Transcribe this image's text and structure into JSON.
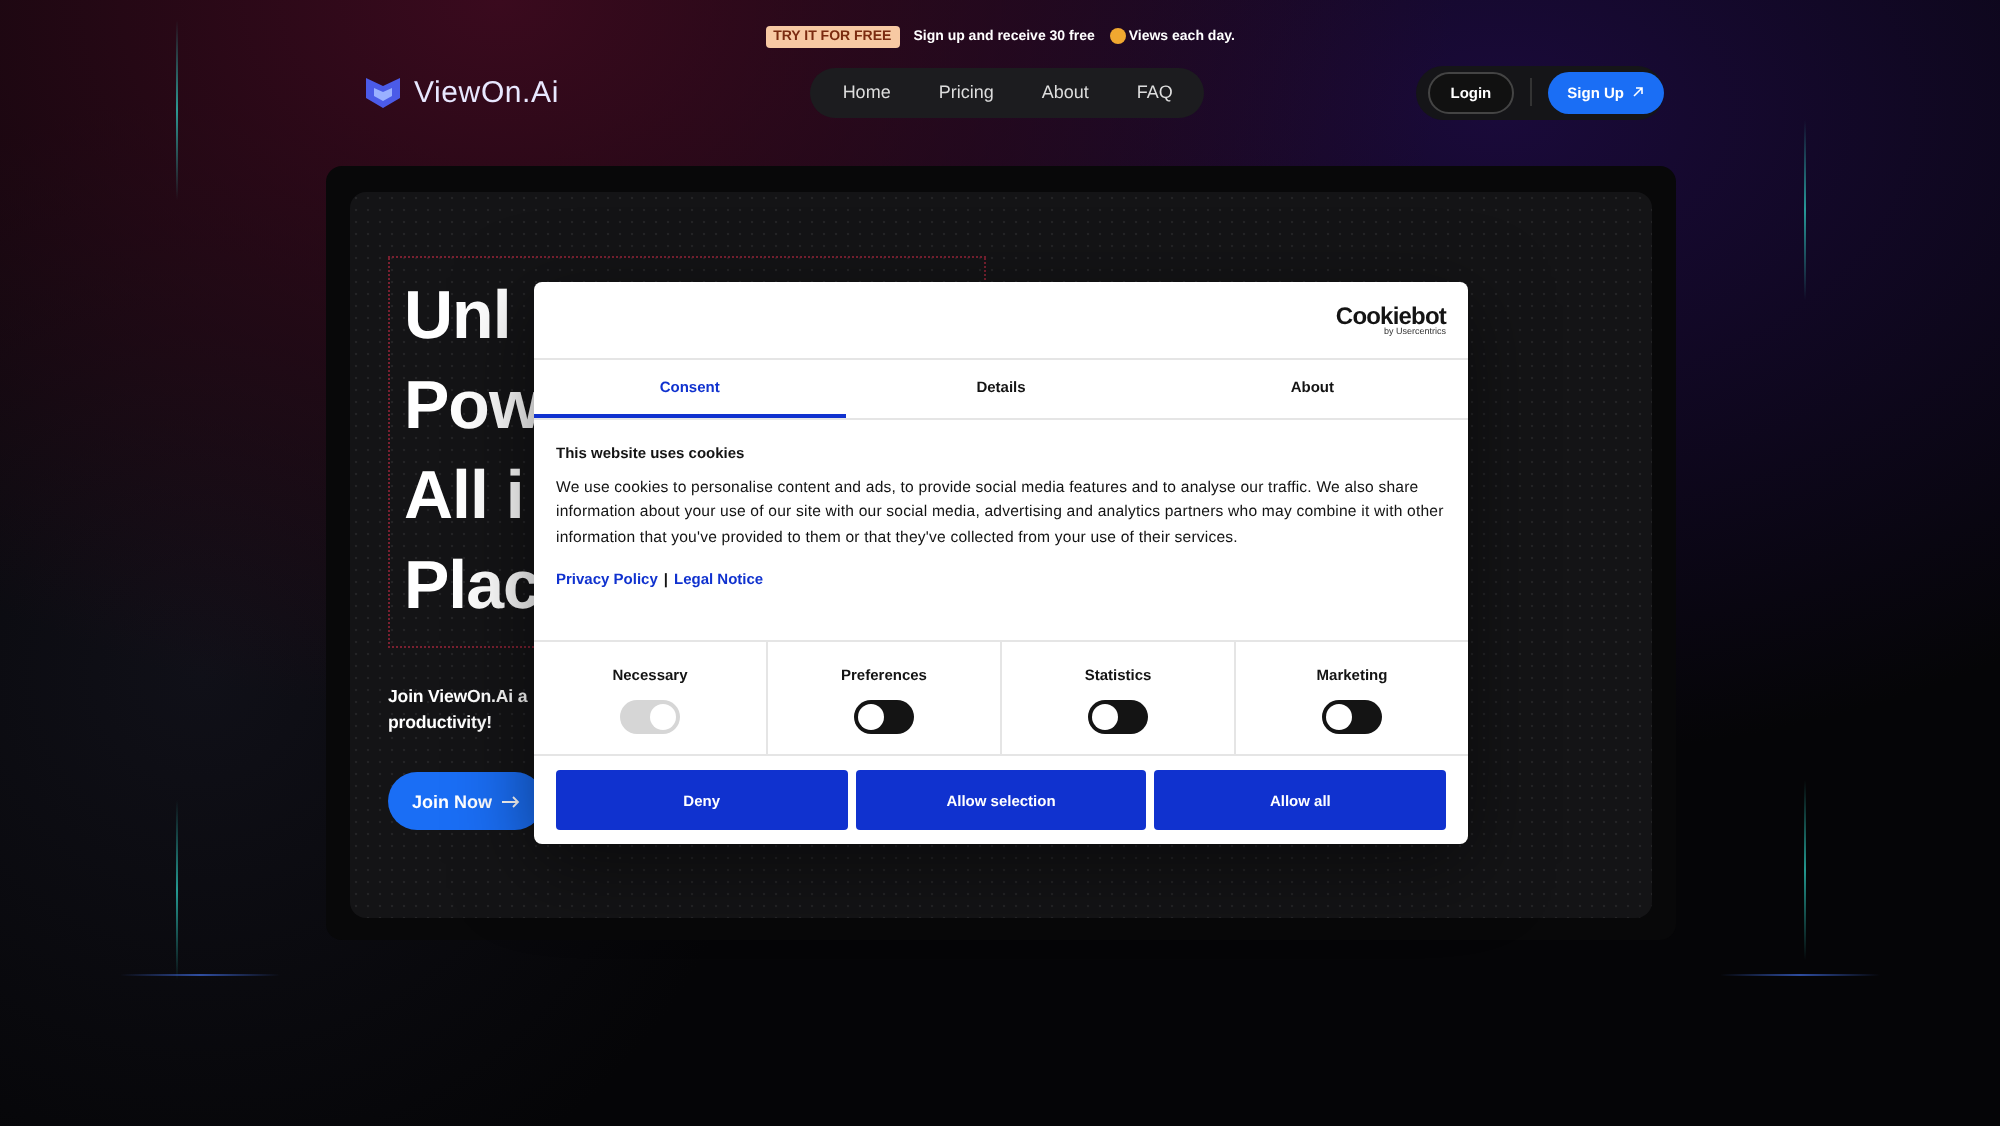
{
  "promo_banner": {
    "badge": "TRY IT FOR FREE",
    "text_before": "Sign up and receive 30 free",
    "text_after": "Views each day."
  },
  "header": {
    "logo": "ViewOn.Ai",
    "nav": [
      {
        "label": "Home"
      },
      {
        "label": "Pricing"
      },
      {
        "label": "About"
      },
      {
        "label": "FAQ"
      }
    ],
    "login": "Login",
    "signup": "Sign Up"
  },
  "hero": {
    "heading_lines": [
      "Unl",
      "Pow",
      "All i",
      "Plac"
    ],
    "subtitle_lines": [
      "Join ViewOn.Ai a",
      "productivity!"
    ],
    "cta": "Join Now"
  },
  "cookie_dialog": {
    "brand": "Cookiebot",
    "brand_sub": "by Usercentrics",
    "tabs": [
      {
        "label": "Consent",
        "selected": true
      },
      {
        "label": "Details",
        "selected": false
      },
      {
        "label": "About",
        "selected": false
      }
    ],
    "title": "This website uses cookies",
    "body": "We use cookies to personalise content and ads, to provide social media features and to analyse our traffic. We also share information about your use of our site with our social media, advertising and analytics partners who may combine it with other information that you've provided to them or that they've collected from your use of their services.",
    "links": [
      "Privacy Policy",
      "Legal Notice"
    ],
    "link_separator": "|",
    "categories": [
      {
        "label": "Necessary",
        "checked": true,
        "disabled": true
      },
      {
        "label": "Preferences",
        "checked": false,
        "disabled": false
      },
      {
        "label": "Statistics",
        "checked": false,
        "disabled": false
      },
      {
        "label": "Marketing",
        "checked": false,
        "disabled": false
      }
    ],
    "buttons": [
      "Deny",
      "Allow selection",
      "Allow all"
    ]
  }
}
